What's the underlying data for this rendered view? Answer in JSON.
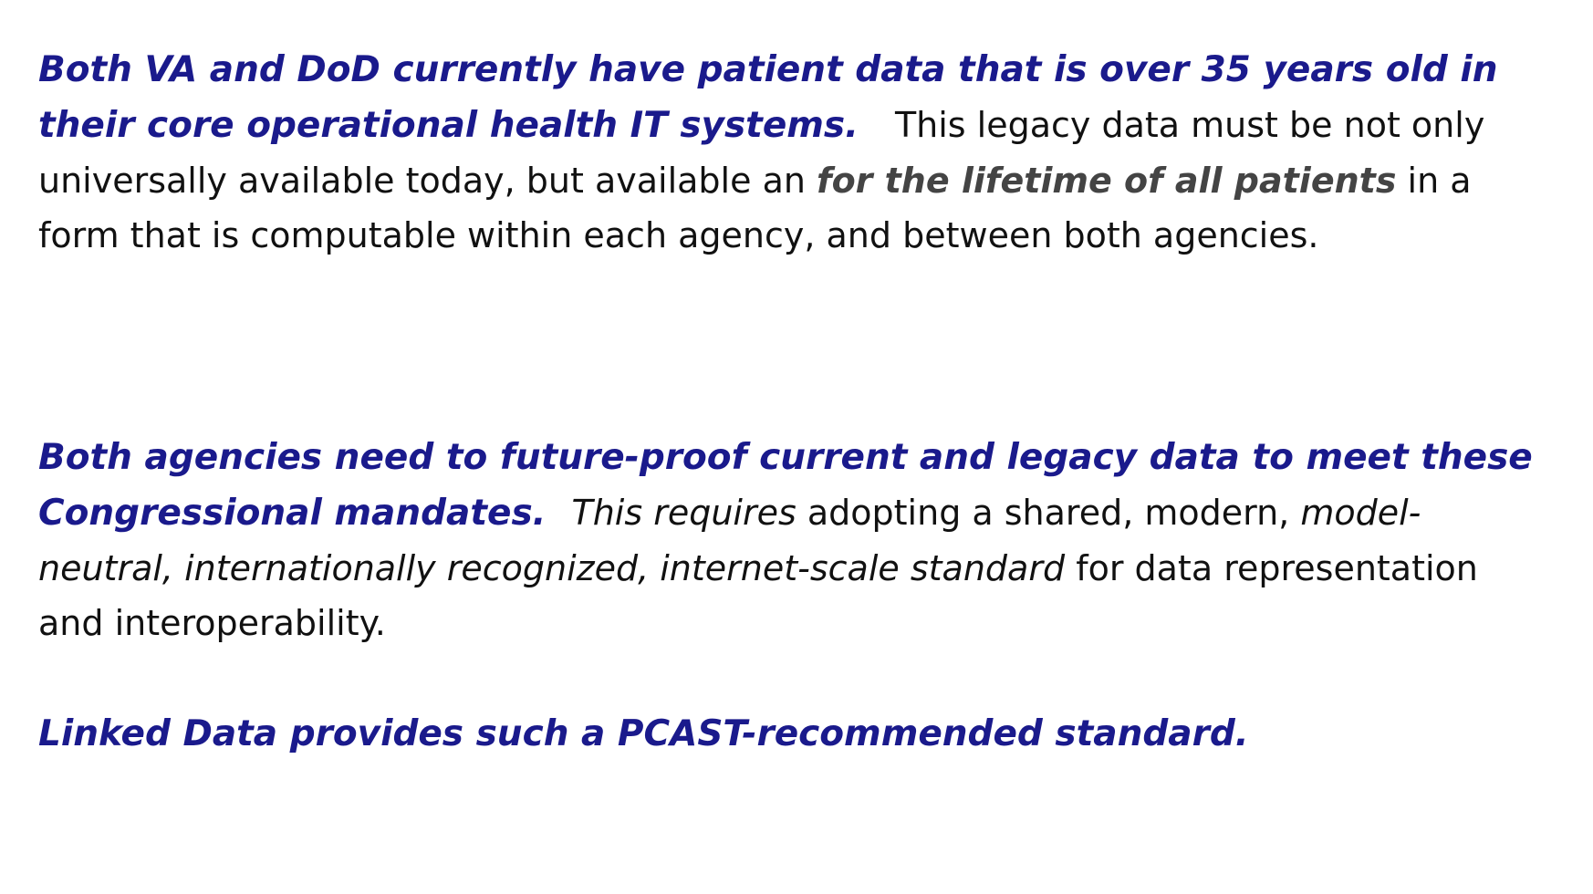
{
  "paragraph_1": {
    "lead": "Both VA and DoD currently have patient data that is over 35 years old in their core operational health IT systems.",
    "body_1": "This legacy data must be not only universally available today, but available an",
    "emphasis": "for the lifetime of all patients",
    "body_2": "in a form that is computable within each agency, and between both agencies."
  },
  "paragraph_2": {
    "lead": "Both agencies need to future-proof current and legacy  data to meet these Congressional mandates.",
    "italic_1": "This requires",
    "body_1": "adopting a shared, modern,",
    "italic_2": "model-neutral, internationally recognized, internet-scale standard",
    "body_2": "for data representation and interoperability."
  },
  "paragraph_3": {
    "lead": "Linked Data provides such a PCAST-recommended standard."
  },
  "colors": {
    "lead_blue": "#1a1a8c",
    "emphasis_gray": "#444444",
    "body_text": "#111111"
  }
}
